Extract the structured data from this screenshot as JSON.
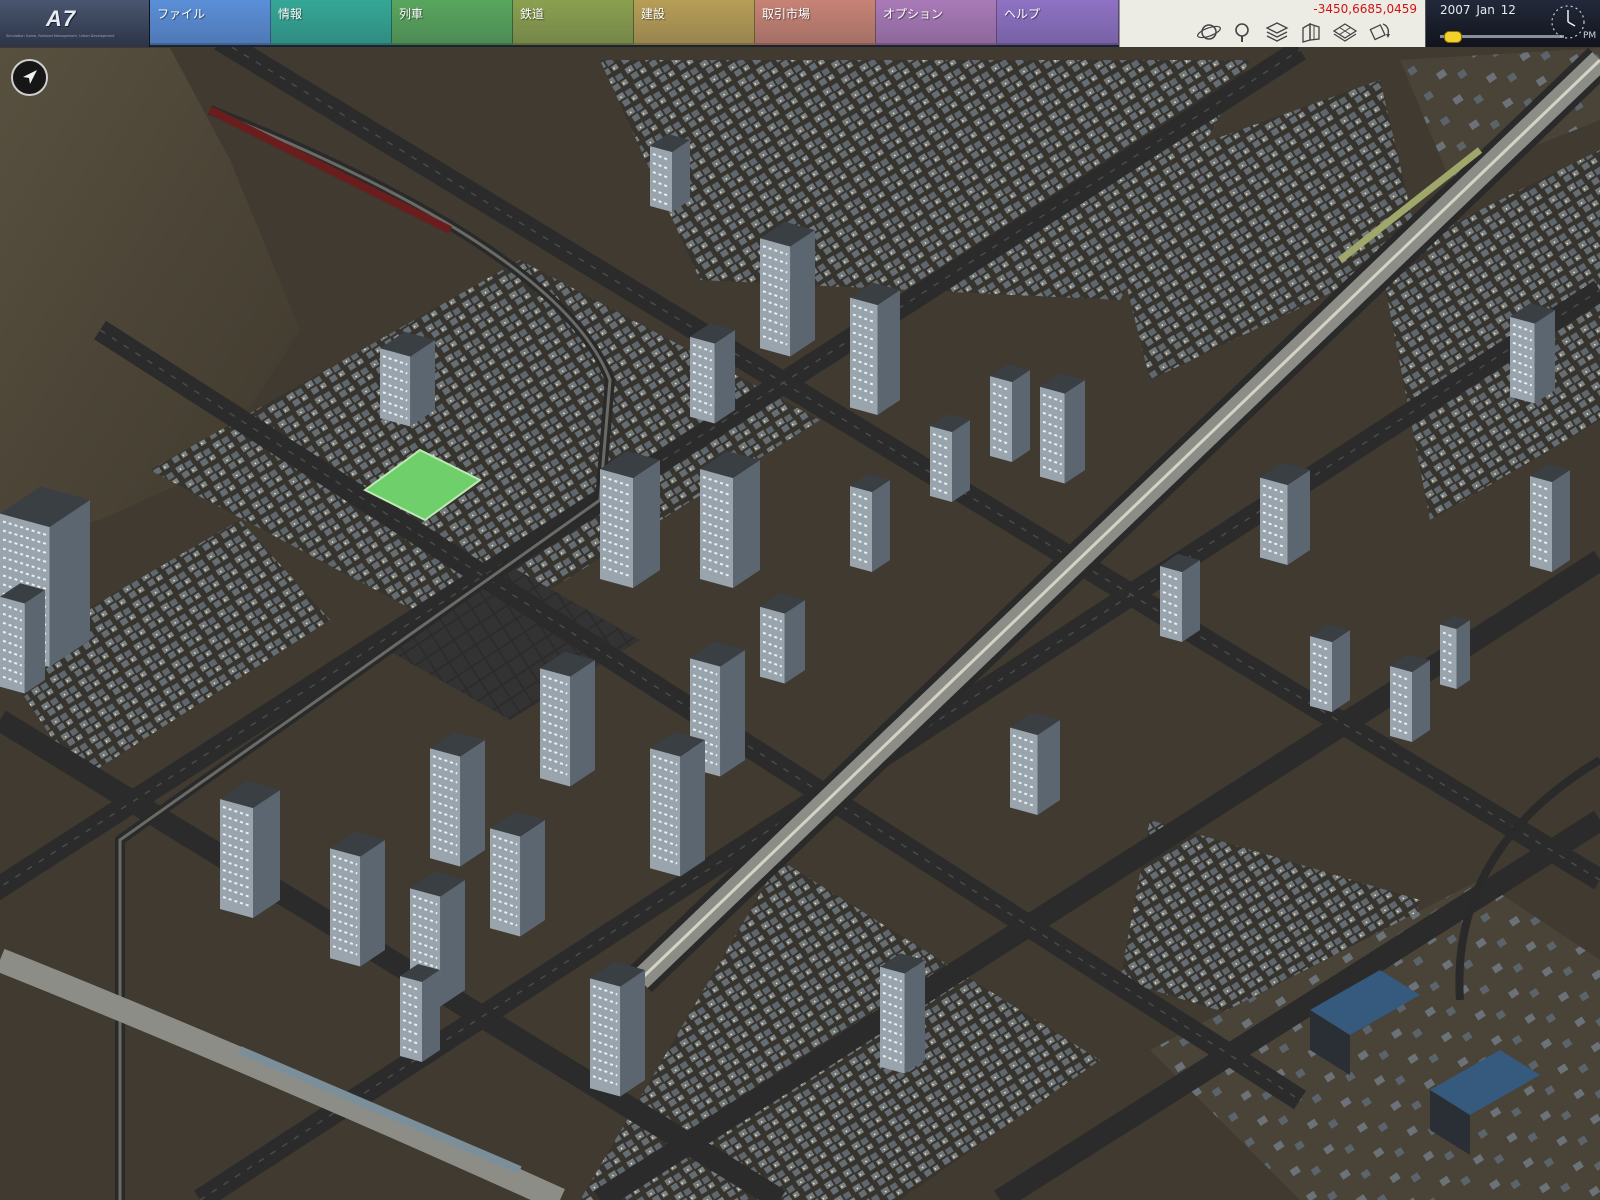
{
  "app": {
    "logo_text": "A7",
    "logo_subtitle": "Simulation Game, Railroad Management, Urban Development"
  },
  "menu": {
    "items": [
      {
        "label": "ファイル",
        "color": "#5b8fd8"
      },
      {
        "label": "情報",
        "color": "#35a796"
      },
      {
        "label": "列車",
        "color": "#59a65e"
      },
      {
        "label": "鉄道",
        "color": "#8ba04f"
      },
      {
        "label": "建設",
        "color": "#b79e57"
      },
      {
        "label": "取引市場",
        "color": "#c78375"
      },
      {
        "label": "オプション",
        "color": "#a97ab7"
      },
      {
        "label": "ヘルプ",
        "color": "#8f72c4"
      }
    ]
  },
  "status": {
    "money": "-3450,6685,0459",
    "money_color": "#d01414"
  },
  "toolbar": {
    "buttons": [
      {
        "name": "planet-view-icon"
      },
      {
        "name": "search-icon"
      },
      {
        "name": "layers-icon"
      },
      {
        "name": "buildings-view-icon"
      },
      {
        "name": "grid-view-icon"
      },
      {
        "name": "rotate-view-icon"
      }
    ]
  },
  "date": {
    "text": "2007  Jan  12",
    "ampm": "PM",
    "speed_level": 0.05
  },
  "map": {
    "compass_icon": "compass-icon"
  }
}
